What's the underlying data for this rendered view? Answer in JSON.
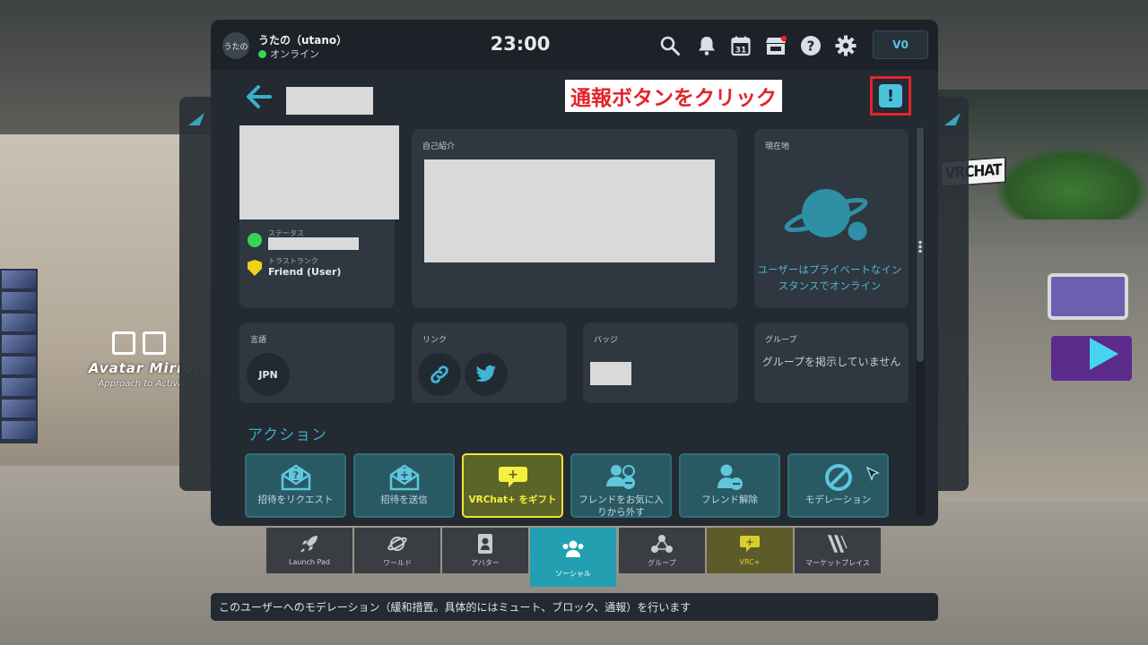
{
  "user": {
    "avatar_text": "うたの",
    "name": "うたの（utano）",
    "status": "オンライン"
  },
  "clock": "23:00",
  "currency": "\u001f0",
  "icons": [
    "search-icon",
    "bell-icon",
    "calendar-icon",
    "store-icon",
    "help-icon",
    "gear-icon"
  ],
  "calendar_day": "31",
  "currency_label": "V0",
  "annotation": "通報ボタンをクリック",
  "profile": {
    "status_label": "ステータス",
    "trust_label": "トラストランク",
    "trust_value": "Friend (User)",
    "intro_label": "自己紹介",
    "location_label": "現在地",
    "location_text": "ユーザーはプライベートなインスタンスでオンライン",
    "language_label": "言語",
    "language_value": "JPN",
    "links_label": "リンク",
    "badges_label": "バッジ",
    "groups_label": "グループ",
    "groups_text": "グループを掲示していません"
  },
  "actions_title": "アクション",
  "actions": [
    {
      "label": "招待をリクエスト",
      "icon": "envelope-question-icon"
    },
    {
      "label": "招待を送信",
      "icon": "envelope-plus-icon"
    },
    {
      "label": "VRChat+ をギフト",
      "icon": "gift-bubble-icon"
    },
    {
      "label": "フレンドをお気に入りから外す",
      "icon": "users-minus-icon"
    },
    {
      "label": "フレンド解除",
      "icon": "user-minus-icon"
    },
    {
      "label": "モデレーション",
      "icon": "block-icon"
    }
  ],
  "dock": [
    {
      "label": "Launch Pad",
      "icon": "rocket-icon"
    },
    {
      "label": "ワールド",
      "icon": "planet-icon"
    },
    {
      "label": "アバター",
      "icon": "avatar-icon"
    },
    {
      "label": "ソーシャル",
      "icon": "people-icon"
    },
    {
      "label": "グループ",
      "icon": "group-icon"
    },
    {
      "label": "VRC+",
      "icon": "vrcplus-icon"
    },
    {
      "label": "マーケットプレイス",
      "icon": "market-icon"
    }
  ],
  "tooltip": "このユーザーへのモデレーション（緩和措置。具体的にはミュート、ブロック、通報）を行います",
  "background": {
    "mirror_title": "Avatar Mirror",
    "mirror_sub": "Approach to Activate",
    "sign": "VRCHAT"
  },
  "colors": {
    "accent": "#37b0cc",
    "annotation_red": "#e3242b",
    "online": "#39d35a",
    "gift_yellow": "#e9e63c"
  }
}
